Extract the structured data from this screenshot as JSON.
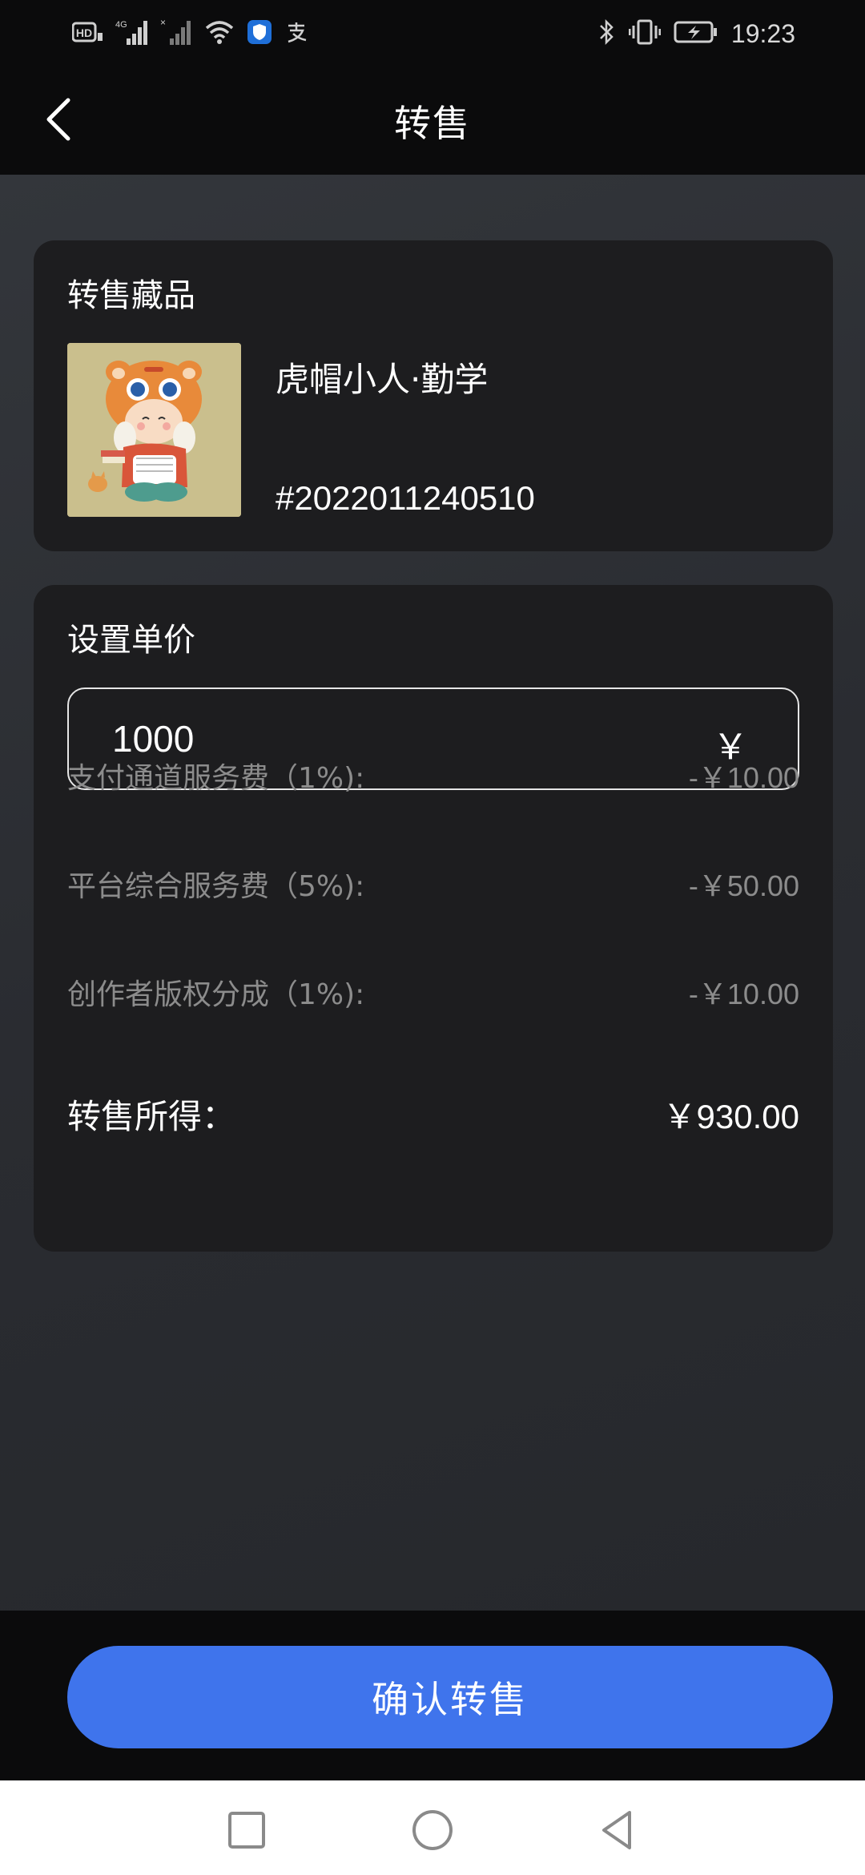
{
  "status_bar": {
    "time": "19:23",
    "signal_text": "4G",
    "hd_text": "HD",
    "left_icons": [
      "hd-icon",
      "signal-4g-icon",
      "signal-x-icon",
      "wifi-icon",
      "shield-app-icon",
      "alipay-icon"
    ],
    "right_icons": [
      "bluetooth-icon",
      "vibrate-icon",
      "battery-charging-icon"
    ]
  },
  "header": {
    "title": "转售",
    "back_icon": "chevron-left-icon"
  },
  "item_card": {
    "title": "转售藏品",
    "name": "虎帽小人·勤学",
    "id": "#2022011240510",
    "thumbnail_icon": "tiger-hat-figure-image"
  },
  "price_card": {
    "title": "设置单价",
    "price_value": "1000",
    "currency": "￥",
    "fees": [
      {
        "label": "支付通道服务费（1%):",
        "value": "-￥10.00"
      },
      {
        "label": "平台综合服务费（5%):",
        "value": "-￥50.00"
      },
      {
        "label": "创作者版权分成（1%):",
        "value": "-￥10.00"
      }
    ],
    "income_label": "转售所得：",
    "income_value": "￥930.00"
  },
  "footer": {
    "confirm_label": "确认转售"
  },
  "system_nav": {
    "icons": [
      "recents-square-icon",
      "home-circle-icon",
      "back-triangle-icon"
    ]
  },
  "colors": {
    "accent": "#3f74ec",
    "card_bg": "#1d1d1f",
    "page_bg": "#2b2d31",
    "muted_text": "#8c8c8c"
  }
}
